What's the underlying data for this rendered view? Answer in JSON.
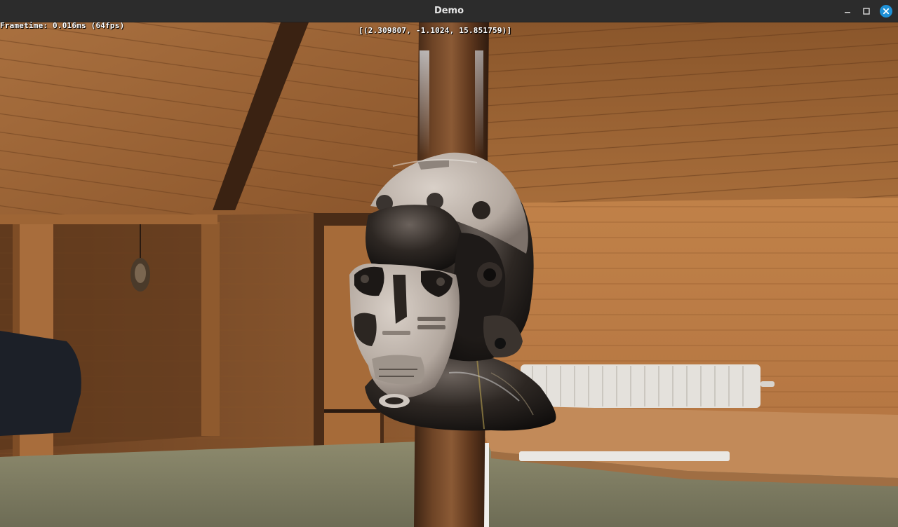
{
  "window": {
    "title": "Demo",
    "controls": {
      "minimize_icon": "minimize-icon",
      "maximize_icon": "maximize-icon",
      "close_icon": "close-icon",
      "close_color": "#1e90d6"
    }
  },
  "hud": {
    "frametime": "Frametime: 0.016ms (64fps)",
    "camera_position": "[(2.309807, -1.1024, 15.851759)]"
  },
  "scene": {
    "subject": "sci-fi-helmet-model",
    "environment": "wooden-attic-room",
    "colors": {
      "wood_light": "#b97a45",
      "wood_dark": "#6b3f1d",
      "floor": "#7f7f64",
      "helmet_shell": "#b9ada4",
      "helmet_dark": "#2b2521"
    }
  }
}
